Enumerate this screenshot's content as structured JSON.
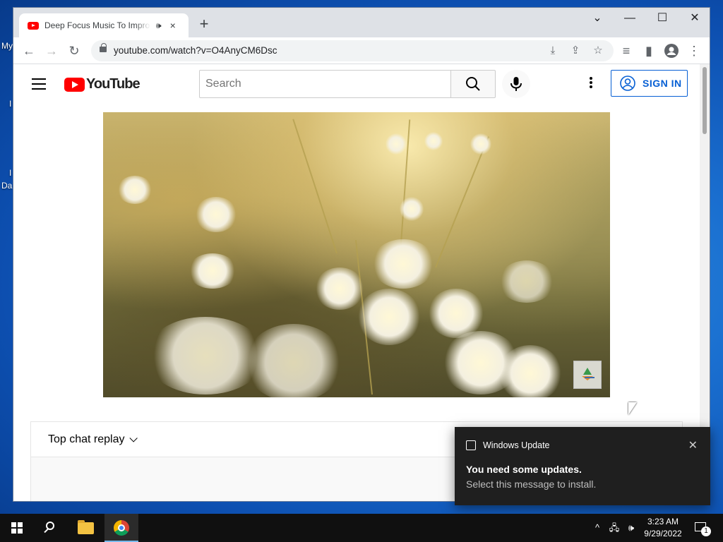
{
  "desktop": {
    "icon_labels": [
      "My",
      "I",
      "I",
      "Da"
    ]
  },
  "browser": {
    "tab": {
      "title": "Deep Focus Music To Improve Concentration",
      "audio_icon": "speaker-icon",
      "close": "×"
    },
    "new_tab": "+",
    "window_controls": {
      "dropdown": "⌄",
      "minimize": "—",
      "maximize": "☐",
      "close": "✕"
    },
    "toolbar": {
      "back": "←",
      "forward": "→",
      "reload": "↻",
      "url": "youtube.com/watch?v=O4AnyCM6Dsc",
      "install": "⤓",
      "share": "⇪",
      "bookmark": "☆",
      "media": "≡",
      "sidepanel": "▮",
      "menu": "⋮"
    }
  },
  "youtube": {
    "logo_text": "YouTube",
    "search_placeholder": "Search",
    "signin_label": "SIGN IN",
    "chat_title": "Top chat replay"
  },
  "toast": {
    "app_name": "Windows Update",
    "close": "✕",
    "title": "You need some updates.",
    "body": "Select this message to install."
  },
  "taskbar": {
    "tray_chevron": "^",
    "network": "🖧",
    "volume": "🕪",
    "time": "3:23 AM",
    "date": "9/29/2022",
    "notification_count": "1"
  },
  "colors": {
    "youtube_red": "#ff0000",
    "signin_blue": "#065fd4",
    "desktop_blue": "#1a6fd0",
    "taskbar": "#101010",
    "toast_bg": "#1f1f1f"
  }
}
